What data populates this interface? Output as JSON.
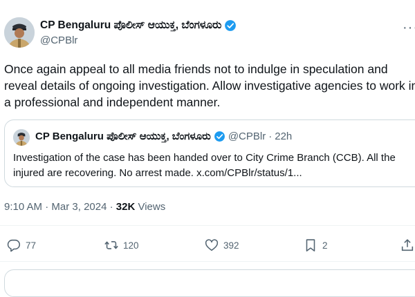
{
  "author": {
    "name": "CP Bengaluru ಪೊಲೀಸ್ ಆಯುಕ್ತ, ಬೆಂಗಳೂರು",
    "handle": "@CPBlr"
  },
  "tweet": {
    "text": "Once again appeal to all media friends not to indulge in speculation and reveal details of ongoing investigation. Allow investigative agencies to work in a professional and  independent manner."
  },
  "quote": {
    "name": "CP Bengaluru ಪೊಲೀಸ್ ಆಯುಕ್ತ, ಬೆಂಗಳೂರು",
    "handle": "@CPBlr",
    "separator": "·",
    "time": "22h",
    "text": "Investigation of the case has been handed over to City Crime Branch (CCB). All the injured are recovering. No arrest made. x.com/CPBlr/status/1..."
  },
  "meta": {
    "time": "9:10 AM",
    "separator": "·",
    "date": "Mar 3, 2024",
    "views_count": "32K",
    "views_label": "Views"
  },
  "actions": {
    "replies": "77",
    "reposts": "120",
    "likes": "392",
    "bookmarks": "2"
  },
  "icons": {
    "verified": "verified-badge-icon",
    "reply": "reply-icon",
    "repost": "repost-icon",
    "like": "heart-icon",
    "bookmark": "bookmark-icon",
    "share": "share-icon",
    "more": "more-icon"
  },
  "colors": {
    "verified": "#1d9bf0",
    "text": "#0f1419",
    "secondary": "#536471",
    "border": "#cfd9de"
  }
}
